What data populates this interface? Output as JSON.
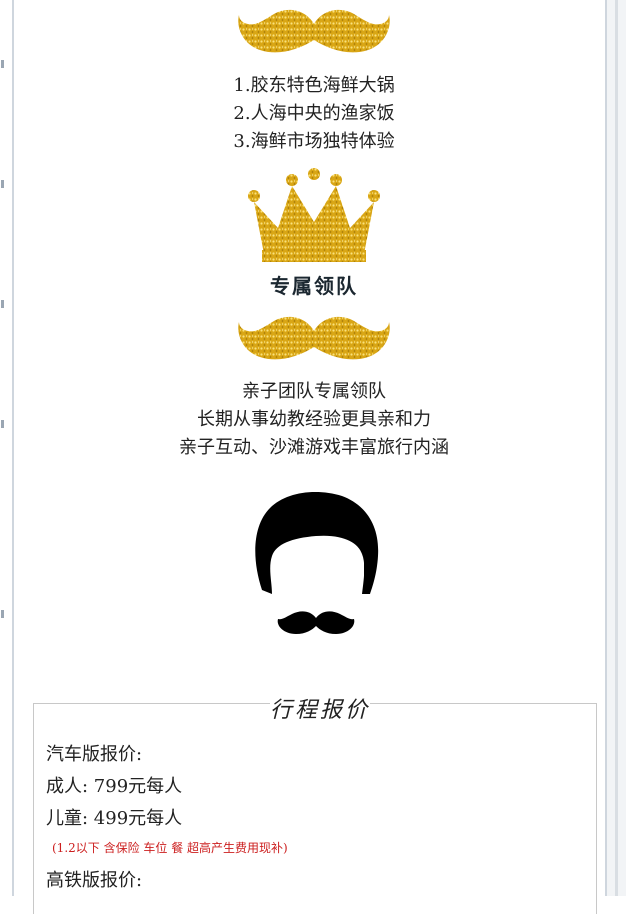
{
  "features": {
    "items": [
      "1.胶东特色海鲜大锅",
      "2.人海中央的渔家饭",
      "3.海鲜市场独特体验"
    ]
  },
  "leader": {
    "title": "专属领队",
    "lines": [
      "亲子团队专属领队",
      "长期从事幼教经验更具亲和力",
      "亲子互动、沙滩游戏丰富旅行内涵"
    ]
  },
  "pricing": {
    "title": "行程报价",
    "bus_heading": "汽车版报价:",
    "adult": "成人: 799元每人",
    "child": "儿童: 499元每人",
    "note": "(1.2以下 含保险 车位 餐 超高产生费用现补)",
    "train_heading": "高铁版报价:"
  },
  "colors": {
    "gold": "#d4a017",
    "gold_light": "#f3d45a",
    "note_red": "#cc1f1f",
    "border": "#c8c8c8"
  },
  "icons": [
    "gold-mustache-icon",
    "gold-crown-icon",
    "man-face-icon"
  ]
}
